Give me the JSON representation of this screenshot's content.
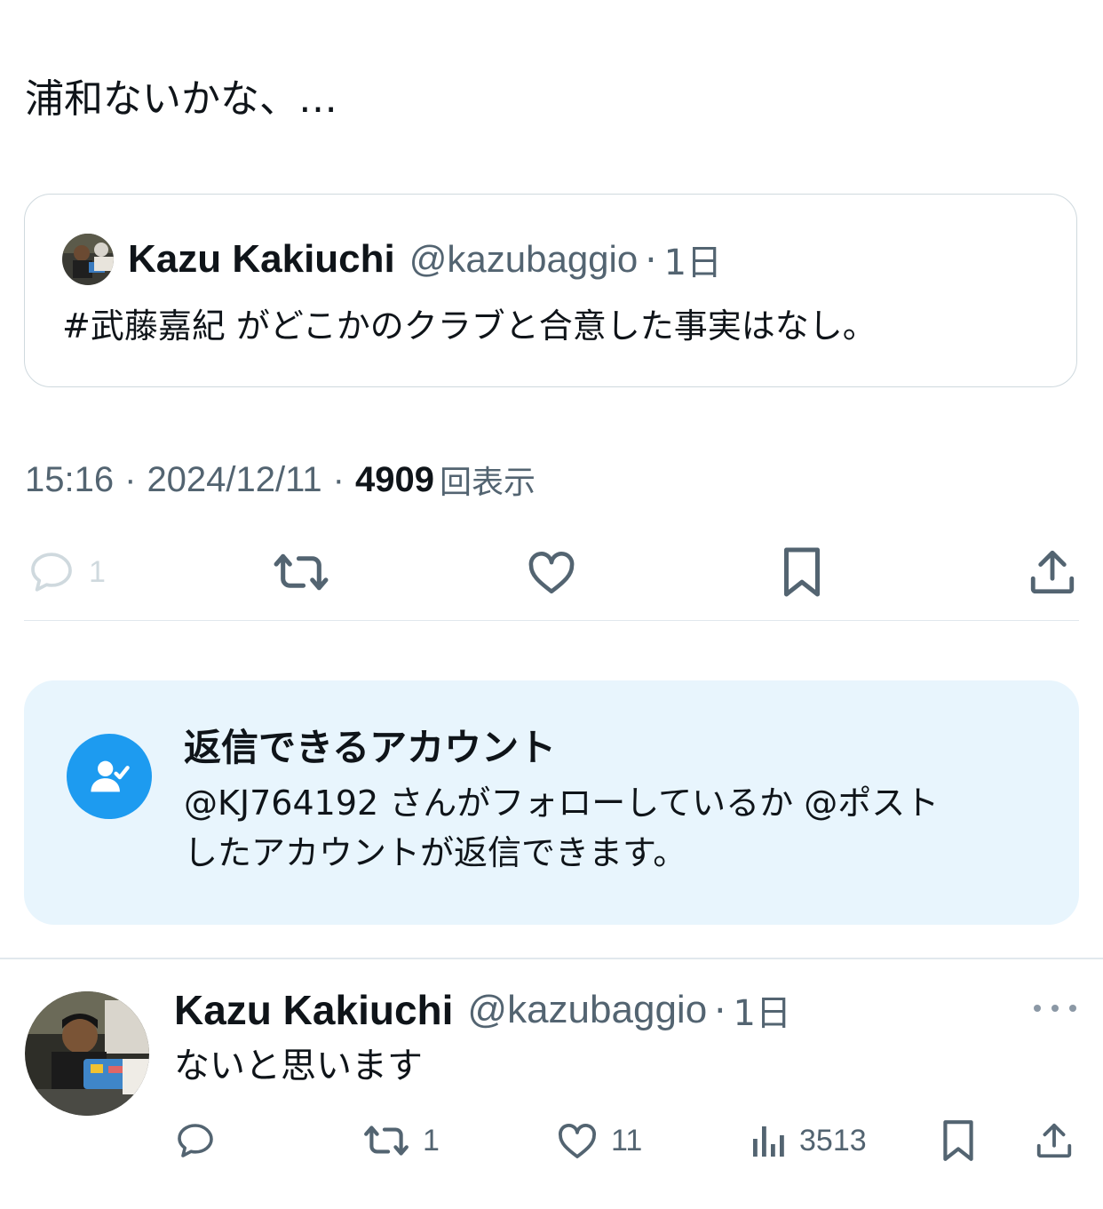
{
  "tweet": {
    "text": "浦和ないかな、…",
    "time": "15:16",
    "date": "2024/12/11",
    "views_count": "4909",
    "views_label": "回表示",
    "reply_count": "1"
  },
  "quote": {
    "name": "Kazu Kakiuchi",
    "handle": "@kazubaggio",
    "time": "1日",
    "text": "#武藤嘉紀 がどこかのクラブと合意した事実はなし。"
  },
  "reply_restriction": {
    "title": "返信できるアカウント",
    "line1": "@KJ764192 さんがフォローしているか @ポスト",
    "line2": "したアカウントが返信できます。"
  },
  "reply": {
    "name": "Kazu Kakiuchi",
    "handle": "@kazubaggio",
    "time": "1日",
    "text": "ないと思います",
    "retweets": "1",
    "likes": "11",
    "views": "3513"
  },
  "colors": {
    "text": "#0f1419",
    "secondary": "#536471",
    "accent": "#1d9bf0",
    "restriction_bg": "#e8f5fd"
  }
}
